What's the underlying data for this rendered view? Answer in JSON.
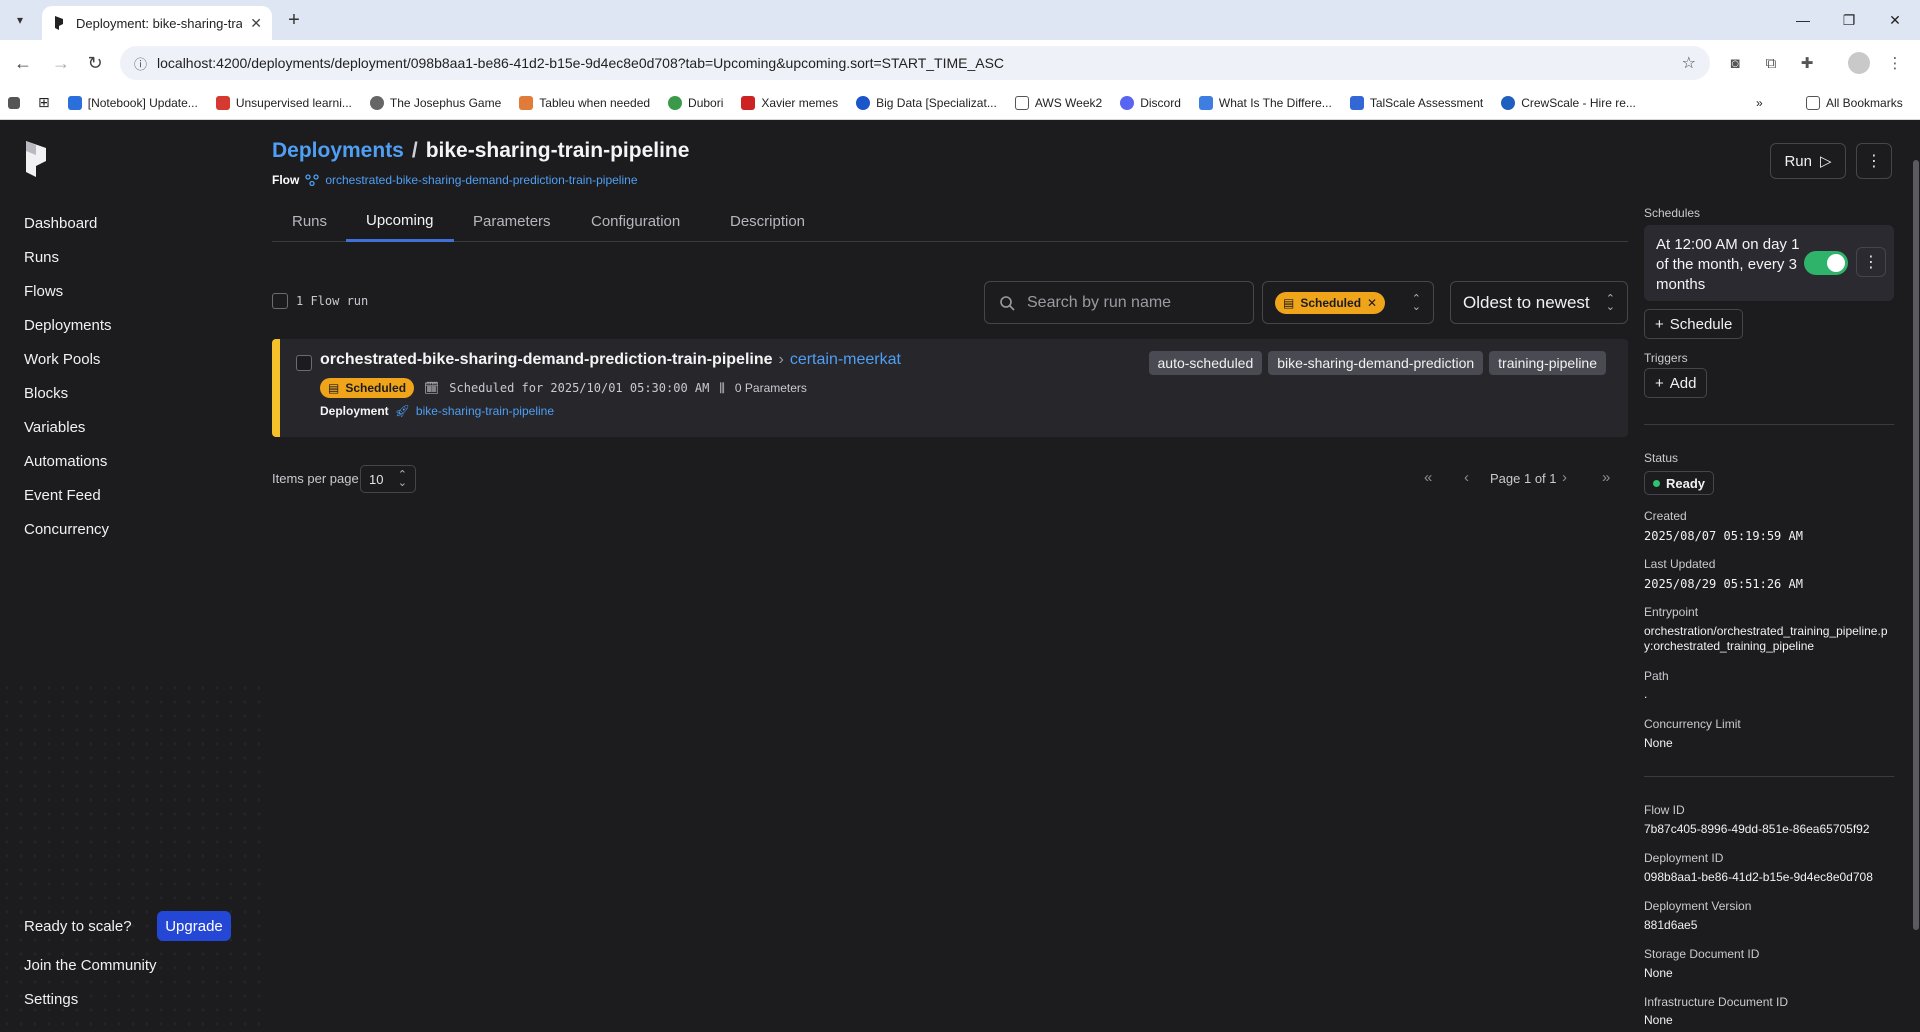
{
  "browser": {
    "tab_title": "Deployment: bike-sharing-train-pipeline",
    "url": "localhost:4200/deployments/deployment/098b8aa1-be86-41d2-b15e-9d4ec8e0d708?tab=Upcoming&upcoming.sort=START_TIME_ASC",
    "bookmarks": [
      "[Notebook] Update...",
      "Unsupervised learni...",
      "The Josephus Game",
      "Tableu when needed",
      "Dubori",
      "Xavier memes",
      "Big Data [Specializat...",
      "AWS Week2",
      "Discord",
      "What Is The Differe...",
      "TalScale Assessment",
      "CrewScale - Hire re..."
    ],
    "all_bookmarks": "All Bookmarks"
  },
  "sidebar": {
    "items": [
      "Dashboard",
      "Runs",
      "Flows",
      "Deployments",
      "Work Pools",
      "Blocks",
      "Variables",
      "Automations",
      "Event Feed",
      "Concurrency"
    ],
    "ready_to_scale": "Ready to scale?",
    "upgrade": "Upgrade",
    "join_community": "Join the Community",
    "settings": "Settings"
  },
  "header": {
    "crumb_root": "Deployments",
    "crumb_sep": "/",
    "title": "bike-sharing-train-pipeline",
    "flow_label": "Flow",
    "flow_name": "orchestrated-bike-sharing-demand-prediction-train-pipeline"
  },
  "tabs": [
    "Runs",
    "Upcoming",
    "Parameters",
    "Configuration",
    "Description"
  ],
  "toolbar": {
    "run_count": "1 Flow run",
    "search_placeholder": "Search by run name",
    "state_filter": "Scheduled",
    "sort": "Oldest to newest"
  },
  "run": {
    "flow": "orchestrated-bike-sharing-demand-prediction-train-pipeline",
    "name": "certain-meerkat",
    "state": "Scheduled",
    "scheduled_for": "Scheduled for 2025/10/01 05:30:00 AM",
    "parameters": "0 Parameters",
    "deployment_label": "Deployment",
    "deployment_name": "bike-sharing-train-pipeline",
    "tags": [
      "auto-scheduled",
      "bike-sharing-demand-prediction",
      "training-pipeline"
    ]
  },
  "pagination": {
    "items_per_page_label": "Items per page",
    "items_per_page": "10",
    "page_text": "Page 1 of 1"
  },
  "details": {
    "run_button": "Run",
    "schedules_label": "Schedules",
    "schedule_text": "At 12:00 AM on day 1 of the month, every 3 months",
    "schedule_button": "Schedule",
    "triggers_label": "Triggers",
    "add_button": "Add",
    "status_label": "Status",
    "status_value": "Ready",
    "created_label": "Created",
    "created_value": "2025/08/07 05:19:59 AM",
    "updated_label": "Last Updated",
    "updated_value": "2025/08/29 05:51:26 AM",
    "entrypoint_label": "Entrypoint",
    "entrypoint_value": "orchestration/orchestrated_training_pipeline.py:orchestrated_training_pipeline",
    "path_label": "Path",
    "path_value": ".",
    "concurrency_label": "Concurrency Limit",
    "concurrency_value": "None",
    "flow_id_label": "Flow ID",
    "flow_id_value": "7b87c405-8996-49dd-851e-86ea65705f92",
    "deployment_id_label": "Deployment ID",
    "deployment_id_value": "098b8aa1-be86-41d2-b15e-9d4ec8e0d708",
    "version_label": "Deployment Version",
    "version_value": "881d6ae5",
    "storage_label": "Storage Document ID",
    "storage_value": "None",
    "infra_label": "Infrastructure Document ID",
    "infra_value": "None"
  },
  "colors": {
    "accent": "#4f9ff5",
    "scheduled": "#f0a41a",
    "ready": "#31c26f",
    "upgrade": "#2447d6"
  }
}
